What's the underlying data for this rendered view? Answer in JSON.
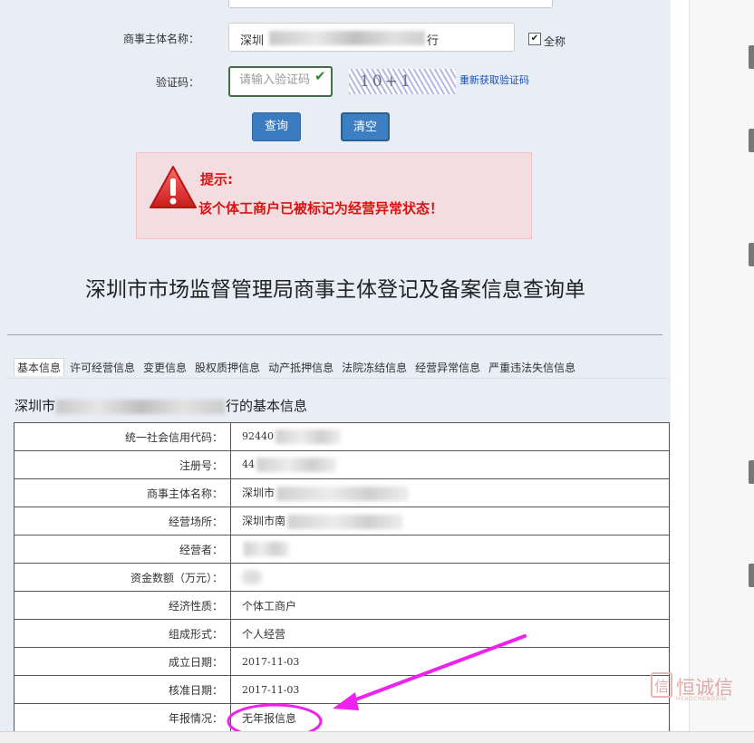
{
  "form": {
    "name_label": "商事主体名称：",
    "name_value_prefix": "深圳",
    "name_value_suffix": "行",
    "fullname_label": "全称",
    "fullname_checked": true,
    "captcha_label": "验证码：",
    "captcha_placeholder": "请输入验证码",
    "captcha_image_text": "10+1",
    "refresh_label": "重新获取验证码",
    "query_button": "查询",
    "clear_button": "清空"
  },
  "alert": {
    "title": "提示:",
    "message": "该个体工商户已被标记为经营异常状态！",
    "icon": "warning-triangle-icon",
    "color": "#dd1111"
  },
  "page_title": "深圳市市场监督管理局商事主体登记及备案信息查询单",
  "tabs": [
    {
      "label": "基本信息",
      "active": true
    },
    {
      "label": "许可经营信息",
      "active": false
    },
    {
      "label": "变更信息",
      "active": false
    },
    {
      "label": "股权质押信息",
      "active": false
    },
    {
      "label": "动产抵押信息",
      "active": false
    },
    {
      "label": "法院冻结信息",
      "active": false
    },
    {
      "label": "经营异常信息",
      "active": false
    },
    {
      "label": "严重违法失信信息",
      "active": false
    }
  ],
  "section": {
    "title_prefix": "深圳市",
    "title_suffix": "行的基本信息"
  },
  "rows": [
    {
      "label": "统一社会信用代码：",
      "value": "92440"
    },
    {
      "label": "注册号：",
      "value": "44"
    },
    {
      "label": "商事主体名称：",
      "value": "深圳市"
    },
    {
      "label": "经营场所：",
      "value": "深圳市南"
    },
    {
      "label": "经营者：",
      "value": ""
    },
    {
      "label": "资金数额（万元）：",
      "value": ""
    },
    {
      "label": "经济性质：",
      "value": "个体工商户"
    },
    {
      "label": "组成形式：",
      "value": "个人经营"
    },
    {
      "label": "成立日期：",
      "value": "2017-11-03"
    },
    {
      "label": "核准日期：",
      "value": "2017-11-03"
    },
    {
      "label": "年报情况：",
      "value": "无年报信息"
    }
  ],
  "watermark": {
    "logo_char": "信",
    "text": "恒诚信",
    "subtext": "HENGCHENGXIN"
  },
  "annotation_color": "#ee22ee"
}
